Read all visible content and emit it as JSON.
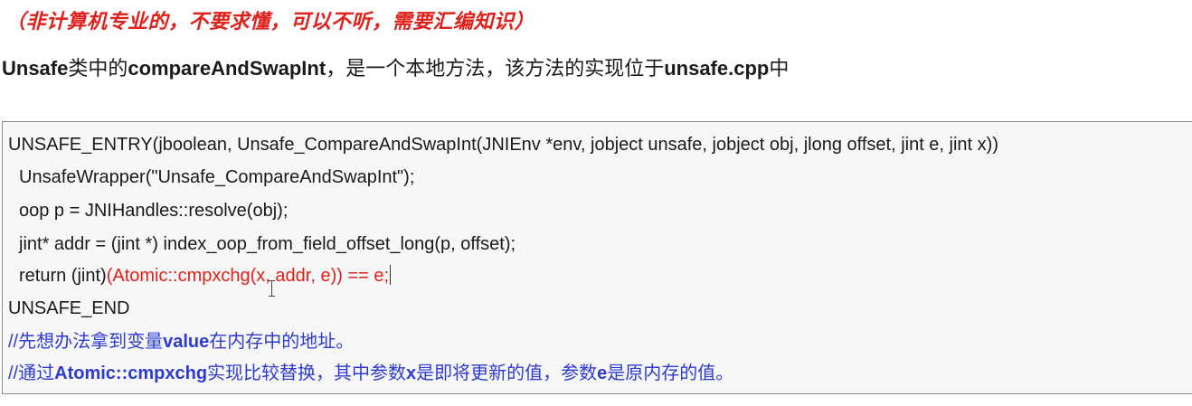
{
  "note": "（非计算机专业的，不要求懂，可以不听，需要汇编知识）",
  "intro": {
    "w1": "Unsafe",
    "t1": "类中的",
    "w2": "compareAndSwapInt",
    "t2": "，是一个本地方法，该方法的实现位于",
    "w3": "unsafe.cpp",
    "t3": "中"
  },
  "code": {
    "line1": "UNSAFE_ENTRY(jboolean, Unsafe_CompareAndSwapInt(JNIEnv *env, jobject unsafe, jobject obj, jlong offset, jint e, jint x))",
    "line2": "UnsafeWrapper(\"Unsafe_CompareAndSwapInt\");",
    "line3": "oop p = JNIHandles::resolve(obj);",
    "line4": "jint* addr = (jint *) index_oop_from_field_offset_long(p, offset);",
    "line5_plain": "return (jint)",
    "line5_red": "(Atomic::cmpxchg(x, addr, e)) == e;",
    "line6": "UNSAFE_END",
    "comment1_a": "//先想办法拿到变量",
    "comment1_b": "value",
    "comment1_c": "在内存中的地址。",
    "comment2_a": "//通过",
    "comment2_b": "Atomic::cmpxchg",
    "comment2_c": "实现比较替换，其中参数",
    "comment2_d": "x",
    "comment2_e": "是即将更新的值，参数",
    "comment2_f": "e",
    "comment2_g": "是原内存的值。"
  },
  "colors": {
    "note": "#e0201b",
    "highlight": "#e0201b",
    "comment": "#2d3bd0"
  }
}
